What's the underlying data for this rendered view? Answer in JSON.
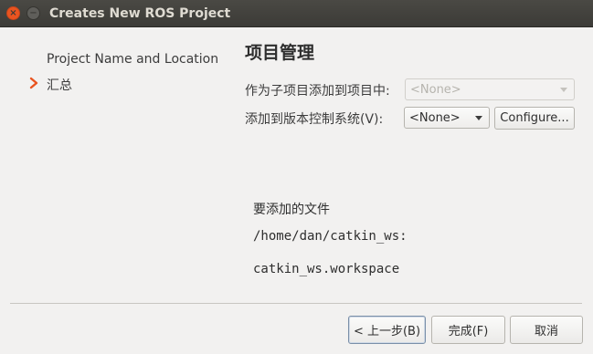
{
  "window": {
    "title": "Creates New ROS Project",
    "close_glyph": "×",
    "minimize_glyph": "−"
  },
  "sidebar": {
    "steps": [
      {
        "label": "Project Name and Location",
        "current": false
      },
      {
        "label": "汇总",
        "current": true
      }
    ],
    "current_marker_icon": "chevron-right-icon",
    "marker_color": "#e95420"
  },
  "main": {
    "title": "项目管理",
    "add_as_subproject_label": "作为子项目添加到项目中:",
    "add_as_subproject_value": "<None>",
    "vcs_label": "添加到版本控制系统(V):",
    "vcs_value": "<None>",
    "configure_label": "Configure..."
  },
  "files": {
    "title": "要添加的文件",
    "path": "/home/dan/catkin_ws:",
    "file": "catkin_ws.workspace"
  },
  "footer": {
    "back_label": "< 上一步(B)",
    "finish_label": "完成(F)",
    "cancel_label": "取消"
  }
}
